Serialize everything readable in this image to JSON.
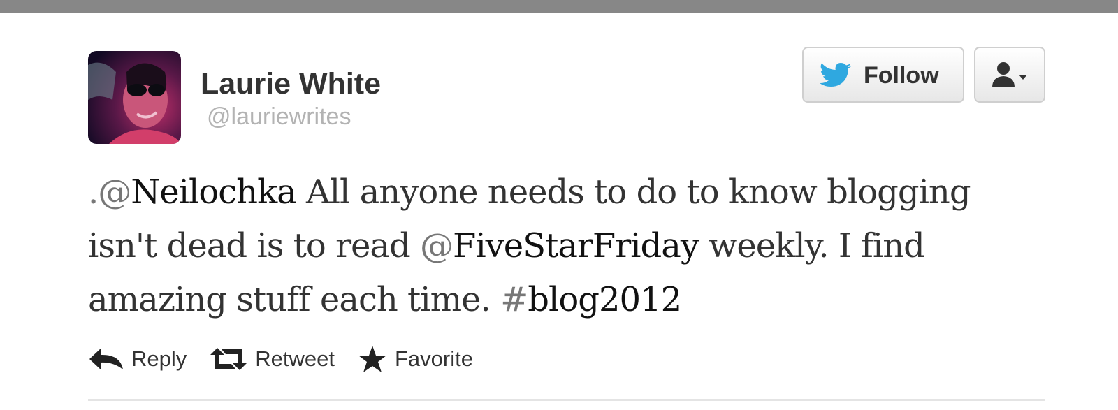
{
  "user": {
    "display_name": "Laurie White",
    "screen_name": "@lauriewrites",
    "avatar_icon": "profile-photo"
  },
  "header": {
    "follow_label": "Follow",
    "follow_icon": "twitter-bird-icon",
    "user_menu_icon": "user-dropdown-icon"
  },
  "tweet": {
    "segments": [
      {
        "text": ".@",
        "kind": "sym"
      },
      {
        "text": "Neilochka",
        "kind": "link"
      },
      {
        "text": " All anyone needs to do to know blogging isn't dead is to read ",
        "kind": "text"
      },
      {
        "text": "@",
        "kind": "sym"
      },
      {
        "text": "FiveStarFriday",
        "kind": "link"
      },
      {
        "text": " weekly. I find amazing stuff each time. ",
        "kind": "text"
      },
      {
        "text": "#",
        "kind": "sym"
      },
      {
        "text": "blog2012",
        "kind": "link"
      }
    ]
  },
  "actions": {
    "reply_label": "Reply",
    "retweet_label": "Retweet",
    "favorite_label": "Favorite"
  },
  "colors": {
    "twitter_blue": "#2fa8e0",
    "text": "#333333",
    "muted": "#b3b3b3"
  }
}
